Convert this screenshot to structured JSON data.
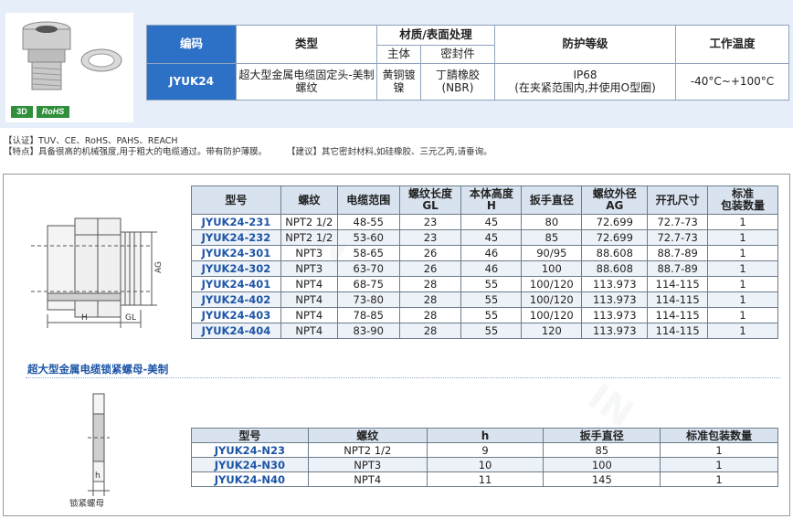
{
  "header": {
    "badges": {
      "three_d": "3D",
      "rohs": "RoHS"
    },
    "columns": {
      "code": "编码",
      "type": "类型",
      "material": "材质/表面处理",
      "body": "主体",
      "seal": "密封件",
      "protection": "防护等级",
      "temperature": "工作温度"
    },
    "row": {
      "code": "JYUK24",
      "type": "超大型金属电缆固定头-美制螺纹",
      "body": "黄铜镀镍",
      "seal": "丁腈橡胶(NBR)",
      "protection_main": "IP68",
      "protection_note": "(在夹紧范围内,并使用O型圈)",
      "temperature": "-40°C~+100°C"
    }
  },
  "notes": {
    "cert": "【认证】TUV、CE、RoHS、PAHS、REACH",
    "feature": "【特点】具备很高的机械强度,用于粗大的电缆通过。带有防护薄膜。",
    "suggest": "【建议】其它密封材料,如硅橡胶、三元乙丙,请垂询。"
  },
  "drawing1": {
    "label_ag": "AG",
    "label_h": "H",
    "label_gl": "GL"
  },
  "drawing2": {
    "label_h": "h",
    "caption": "锁紧螺母"
  },
  "table1": {
    "headers": [
      "型号",
      "螺纹",
      "电缆范围",
      "螺纹长度\nGL",
      "本体高度\nH",
      "扳手直径",
      "螺纹外径\nAG",
      "开孔尺寸",
      "标准\n包装数量"
    ],
    "rows": [
      [
        "JYUK24-231",
        "NPT2 1/2",
        "48-55",
        "23",
        "45",
        "80",
        "72.699",
        "72.7-73",
        "1"
      ],
      [
        "JYUK24-232",
        "NPT2 1/2",
        "53-60",
        "23",
        "45",
        "85",
        "72.699",
        "72.7-73",
        "1"
      ],
      [
        "JYUK24-301",
        "NPT3",
        "58-65",
        "26",
        "46",
        "90/95",
        "88.608",
        "88.7-89",
        "1"
      ],
      [
        "JYUK24-302",
        "NPT3",
        "63-70",
        "26",
        "46",
        "100",
        "88.608",
        "88.7-89",
        "1"
      ],
      [
        "JYUK24-401",
        "NPT4",
        "68-75",
        "28",
        "55",
        "100/120",
        "113.973",
        "114-115",
        "1"
      ],
      [
        "JYUK24-402",
        "NPT4",
        "73-80",
        "28",
        "55",
        "100/120",
        "113.973",
        "114-115",
        "1"
      ],
      [
        "JYUK24-403",
        "NPT4",
        "78-85",
        "28",
        "55",
        "100/120",
        "113.973",
        "114-115",
        "1"
      ],
      [
        "JYUK24-404",
        "NPT4",
        "83-90",
        "28",
        "55",
        "120",
        "113.973",
        "114-115",
        "1"
      ]
    ]
  },
  "section2_title": "超大型金属电缆锁紧螺母-美制",
  "table2": {
    "headers": [
      "型号",
      "螺纹",
      "h",
      "扳手直径",
      "标准包装数量"
    ],
    "rows": [
      [
        "JYUK24-N23",
        "NPT2 1/2",
        "9",
        "85",
        "1"
      ],
      [
        "JYUK24-N30",
        "NPT3",
        "10",
        "100",
        "1"
      ],
      [
        "JYUK24-N40",
        "NPT4",
        "11",
        "145",
        "1"
      ]
    ]
  },
  "colors": {
    "accent_blue": "#2d71c6",
    "model_blue": "#1d55a7",
    "header_bg": "#e5eef9",
    "badge_green": "#2f8f3a"
  }
}
